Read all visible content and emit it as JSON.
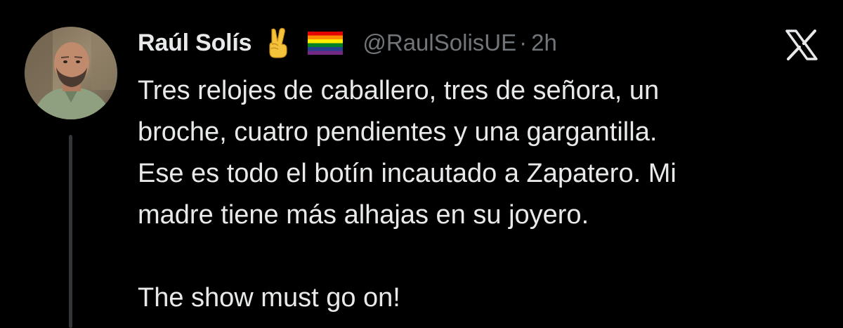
{
  "tweet": {
    "author": {
      "display_name": "Raúl Solís",
      "handle": "@RaulSolisUE",
      "badges": [
        "victory-hand-emoji",
        "rainbow-flag-emoji"
      ]
    },
    "timestamp": "2h",
    "separator": "·",
    "body_paragraph_1": "Tres relojes de caballero, tres de señora, un\nbroche, cuatro pendientes y una gargantilla.\nEse es todo el botín incautado a Zapatero. Mi\nmadre tiene más alhajas en su joyero.",
    "body_paragraph_2": "The show must go on!",
    "platform_logo": "x-logo"
  },
  "colors": {
    "background": "#000000",
    "primary_text": "#e7e9ea",
    "secondary_text": "#71767b",
    "thread_line": "#333639"
  }
}
